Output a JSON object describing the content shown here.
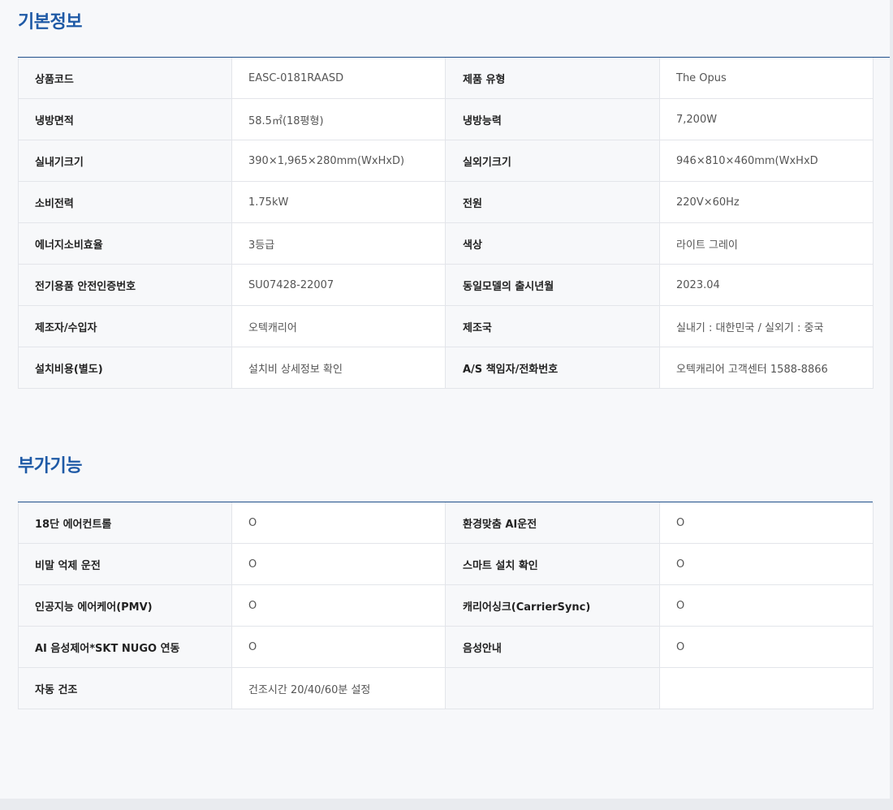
{
  "basic": {
    "title": "기본정보",
    "rows": [
      {
        "k1": "상품코드",
        "v1": "EASC-0181RAASD",
        "k2": "제품 유형",
        "v2": "The Opus"
      },
      {
        "k1": "냉방면적",
        "v1": "58.5㎡(18평형)",
        "k2": "냉방능력",
        "v2": "7,200W"
      },
      {
        "k1": "실내기크기",
        "v1": "390×1,965×280mm(WxHxD)",
        "k2": "실외기크기",
        "v2": "946×810×460mm(WxHxD"
      },
      {
        "k1": "소비전력",
        "v1": "1.75kW",
        "k2": "전원",
        "v2": "220V×60Hz"
      },
      {
        "k1": "에너지소비효율",
        "v1": "3등급",
        "k2": "색상",
        "v2": "라이트 그레이"
      },
      {
        "k1": "전기용품 안전인증번호",
        "v1": "SU07428-22007",
        "k2": "동일모델의 출시년월",
        "v2": "2023.04"
      },
      {
        "k1": "제조자/수입자",
        "v1": "오텍캐리어",
        "k2": "제조국",
        "v2": "실내기 : 대한민국 / 실외기 : 중국"
      },
      {
        "k1": "설치비용(별도)",
        "v1": "설치비 상세정보 확인",
        "k2": "A/S 책임자/전화번호",
        "v2": "오텍캐리어 고객센터 1588-8866"
      }
    ]
  },
  "extra": {
    "title": "부가기능",
    "rows": [
      {
        "k1": "18단 에어컨트롤",
        "v1": "O",
        "k2": "환경맞춤 AI운전",
        "v2": "O"
      },
      {
        "k1": "비말 억제 운전",
        "v1": "O",
        "k2": "스마트 설치 확인",
        "v2": "O"
      },
      {
        "k1": "인공지능 에어케어(PMV)",
        "v1": "O",
        "k2": "캐리어싱크(CarrierSync)",
        "v2": "O"
      },
      {
        "k1": "AI 음성제어*SKT NUGO 연동",
        "v1": "O",
        "k2": "음성안내",
        "v2": "O"
      },
      {
        "k1": "자동 건조",
        "v1": "건조시간 20/40/60분 설정",
        "k2": "",
        "v2": ""
      }
    ]
  }
}
